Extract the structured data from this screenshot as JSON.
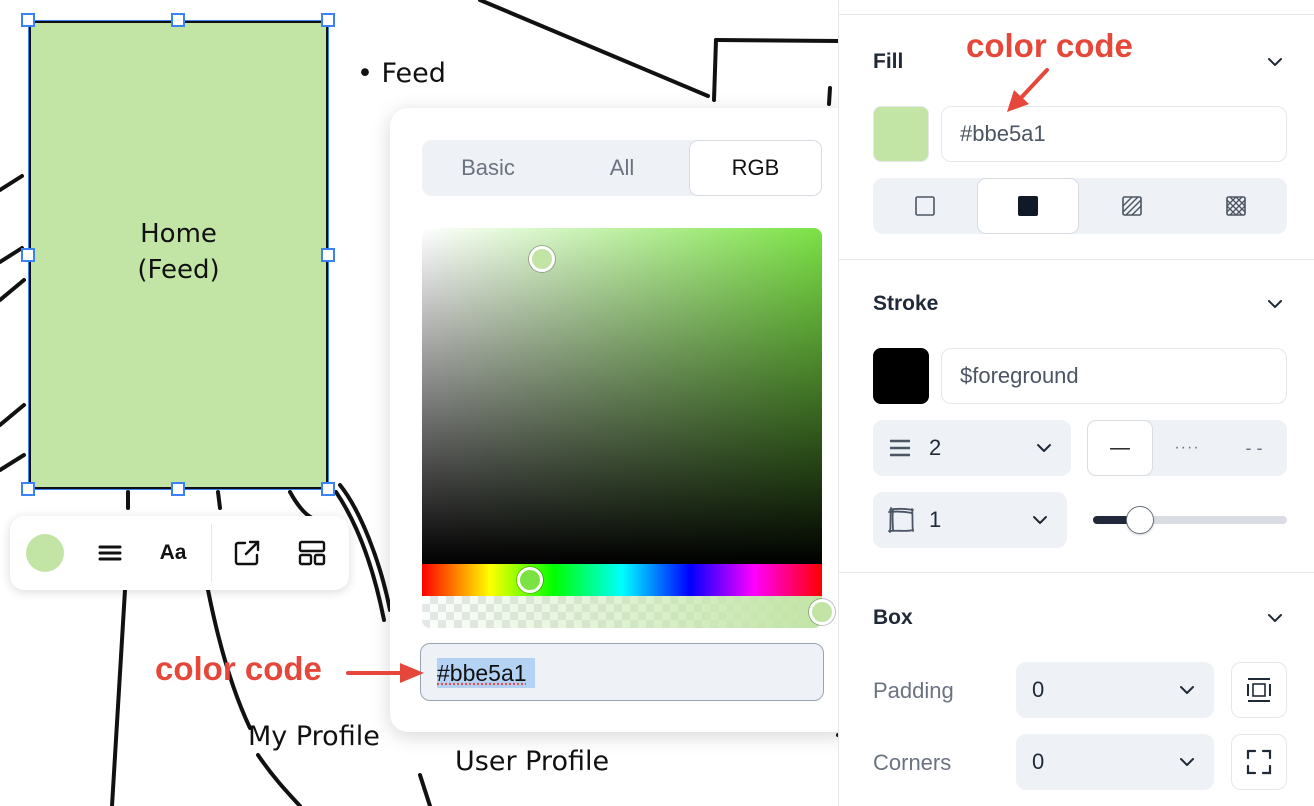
{
  "canvas": {
    "home_node_label": "Home\n(Feed)",
    "feed_text": "• Feed",
    "my_profile_text": "My Profile",
    "user_profile_text": "User Profile",
    "node_fill_color": "#c2e5a6"
  },
  "floating_toolbar": {
    "swatch_color": "#c2e5a6",
    "font_label": "Aa",
    "icons": [
      "fill-swatch-icon",
      "align-lines-icon",
      "font-icon",
      "external-link-icon",
      "layout-icon"
    ]
  },
  "color_picker": {
    "tabs": [
      {
        "label": "Basic",
        "active": false
      },
      {
        "label": "All",
        "active": false
      },
      {
        "label": "RGB",
        "active": true
      }
    ],
    "hex_value": "#bbe5a1",
    "base_hue_color": "#7be244"
  },
  "annotations": {
    "top": "color code",
    "left": "color code",
    "color": "#e5483a"
  },
  "panel": {
    "fill": {
      "title": "Fill",
      "swatch_color": "#c2e5a6",
      "value": "#bbe5a1",
      "styles": [
        "fill-none-icon",
        "fill-solid-icon",
        "fill-hatch-icon",
        "fill-crosshatch-icon"
      ],
      "active_style": "fill-solid-icon"
    },
    "stroke": {
      "title": "Stroke",
      "swatch_color": "#000000",
      "value": "$foreground",
      "width": "2",
      "dash_styles": [
        "—",
        "····",
        "- -"
      ],
      "roughness": "1",
      "slider_fraction": 0.24
    },
    "box": {
      "title": "Box",
      "padding_label": "Padding",
      "padding_value": "0",
      "corners_label": "Corners",
      "corners_value": "0"
    }
  },
  "colors": {
    "accent": "#3b82f6",
    "panel_bg": "#eef2f7"
  }
}
